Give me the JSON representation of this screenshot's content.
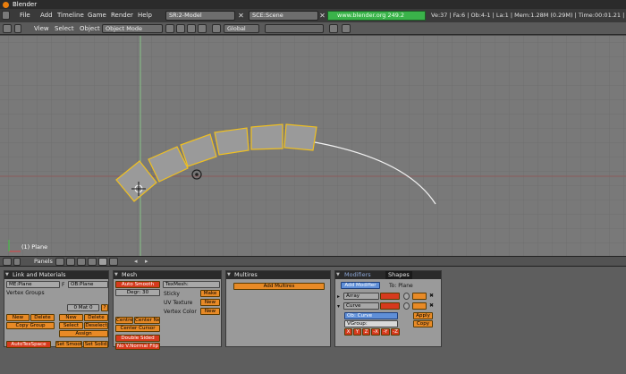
{
  "window": {
    "title": "Blender"
  },
  "topbar": {
    "menus": [
      "File",
      "Add",
      "Timeline",
      "Game",
      "Render",
      "Help"
    ],
    "screen": "SR:2-Model",
    "scene": "SCE:Scene",
    "url": "www.blender.org 249.2",
    "stats": "Ve:37 | Fa:6 | Ob:4-1 | La:1  | Mem:1.28M (0.29M) | Time:00:01.21 | Plane"
  },
  "view_header": {
    "menus": [
      "View",
      "Select",
      "Object"
    ],
    "mode": "Object Mode",
    "orientation": "Global"
  },
  "viewport": {
    "object_label": "(1) Plane"
  },
  "buttons_header": {
    "panels_label": "Panels"
  },
  "link_materials": {
    "title": "Link and Materials",
    "me_field": "ME:Plane",
    "f_label": "F",
    "ob_field": "OB:Plane",
    "vertex_groups": "Vertex Groups",
    "mat_field": "0 Mat 0",
    "question": "?",
    "new1": "New",
    "delete1": "Delete",
    "copy_group": "Copy Group",
    "new2": "New",
    "delete2": "Delete",
    "select": "Select",
    "deselect": "Deselect",
    "assign": "Assign",
    "autotexspace": "AutoTexSpace",
    "set_smooth": "Set Smooth",
    "set_solid": "Set Solid"
  },
  "mesh": {
    "title": "Mesh",
    "auto_smooth": "Auto Smooth",
    "degr": "Degr: 30",
    "texmesh": "TexMesh:",
    "sticky": "Sticky",
    "make": "Make",
    "uv_texture": "UV Texture",
    "new_uv": "New",
    "vertex_color": "Vertex Color",
    "new_vc": "New",
    "centre": "Centre",
    "center_new": "Center New",
    "center_cursor": "Center Cursor",
    "double_sided": "Double Sided",
    "no_vnormal_flip": "No V.Normal Flip"
  },
  "multires": {
    "title": "Multires",
    "add_multires": "Add Multires"
  },
  "modifiers": {
    "tab_modifiers": "Modifiers",
    "tab_shapes": "Shapes",
    "add_modifier": "Add Modifier",
    "to_label": "To: Plane",
    "array": "Array",
    "curve": "Curve",
    "ob_curve": "Ob: Curve",
    "vgroup": "VGroup:",
    "axes": [
      "X",
      "Y",
      "Z",
      "-X",
      "-Y",
      "-Z"
    ],
    "apply": "Apply",
    "copy": "Copy"
  }
}
